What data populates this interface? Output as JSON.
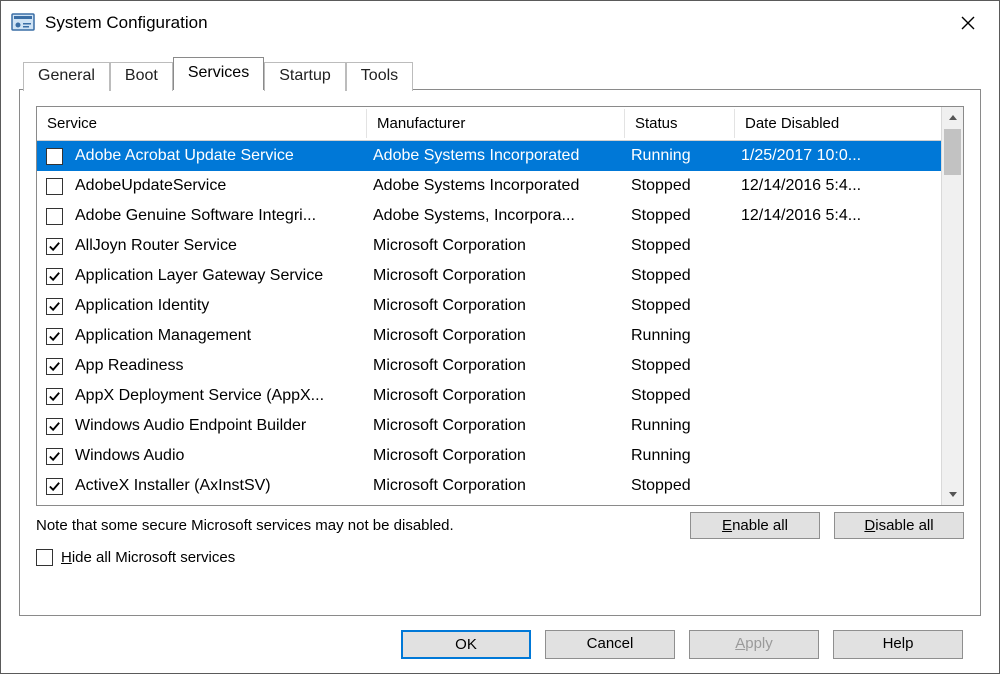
{
  "window": {
    "title": "System Configuration"
  },
  "tabs": {
    "items": [
      "General",
      "Boot",
      "Services",
      "Startup",
      "Tools"
    ],
    "active_index": 2
  },
  "table": {
    "headers": {
      "service": "Service",
      "manufacturer": "Manufacturer",
      "status": "Status",
      "date_disabled": "Date Disabled"
    },
    "rows": [
      {
        "checked": false,
        "selected": true,
        "service": "Adobe Acrobat Update Service",
        "manufacturer": "Adobe Systems Incorporated",
        "status": "Running",
        "date": "1/25/2017 10:0..."
      },
      {
        "checked": false,
        "selected": false,
        "service": "AdobeUpdateService",
        "manufacturer": "Adobe Systems Incorporated",
        "status": "Stopped",
        "date": "12/14/2016 5:4..."
      },
      {
        "checked": false,
        "selected": false,
        "service": "Adobe Genuine Software Integri...",
        "manufacturer": "Adobe Systems, Incorpora...",
        "status": "Stopped",
        "date": "12/14/2016 5:4..."
      },
      {
        "checked": true,
        "selected": false,
        "service": "AllJoyn Router Service",
        "manufacturer": "Microsoft Corporation",
        "status": "Stopped",
        "date": ""
      },
      {
        "checked": true,
        "selected": false,
        "service": "Application Layer Gateway Service",
        "manufacturer": "Microsoft Corporation",
        "status": "Stopped",
        "date": ""
      },
      {
        "checked": true,
        "selected": false,
        "service": "Application Identity",
        "manufacturer": "Microsoft Corporation",
        "status": "Stopped",
        "date": ""
      },
      {
        "checked": true,
        "selected": false,
        "service": "Application Management",
        "manufacturer": "Microsoft Corporation",
        "status": "Running",
        "date": ""
      },
      {
        "checked": true,
        "selected": false,
        "service": "App Readiness",
        "manufacturer": "Microsoft Corporation",
        "status": "Stopped",
        "date": ""
      },
      {
        "checked": true,
        "selected": false,
        "service": "AppX Deployment Service (AppX...",
        "manufacturer": "Microsoft Corporation",
        "status": "Stopped",
        "date": ""
      },
      {
        "checked": true,
        "selected": false,
        "service": "Windows Audio Endpoint Builder",
        "manufacturer": "Microsoft Corporation",
        "status": "Running",
        "date": ""
      },
      {
        "checked": true,
        "selected": false,
        "service": "Windows Audio",
        "manufacturer": "Microsoft Corporation",
        "status": "Running",
        "date": ""
      },
      {
        "checked": true,
        "selected": false,
        "service": "ActiveX Installer (AxInstSV)",
        "manufacturer": "Microsoft Corporation",
        "status": "Stopped",
        "date": ""
      }
    ]
  },
  "note": "Note that some secure Microsoft services may not be disabled.",
  "buttons": {
    "enable_all": "Enable all",
    "disable_all": "Disable all",
    "ok": "OK",
    "cancel": "Cancel",
    "apply": "Apply",
    "help": "Help"
  },
  "hide_ms": {
    "label": "Hide all Microsoft services",
    "checked": false
  }
}
